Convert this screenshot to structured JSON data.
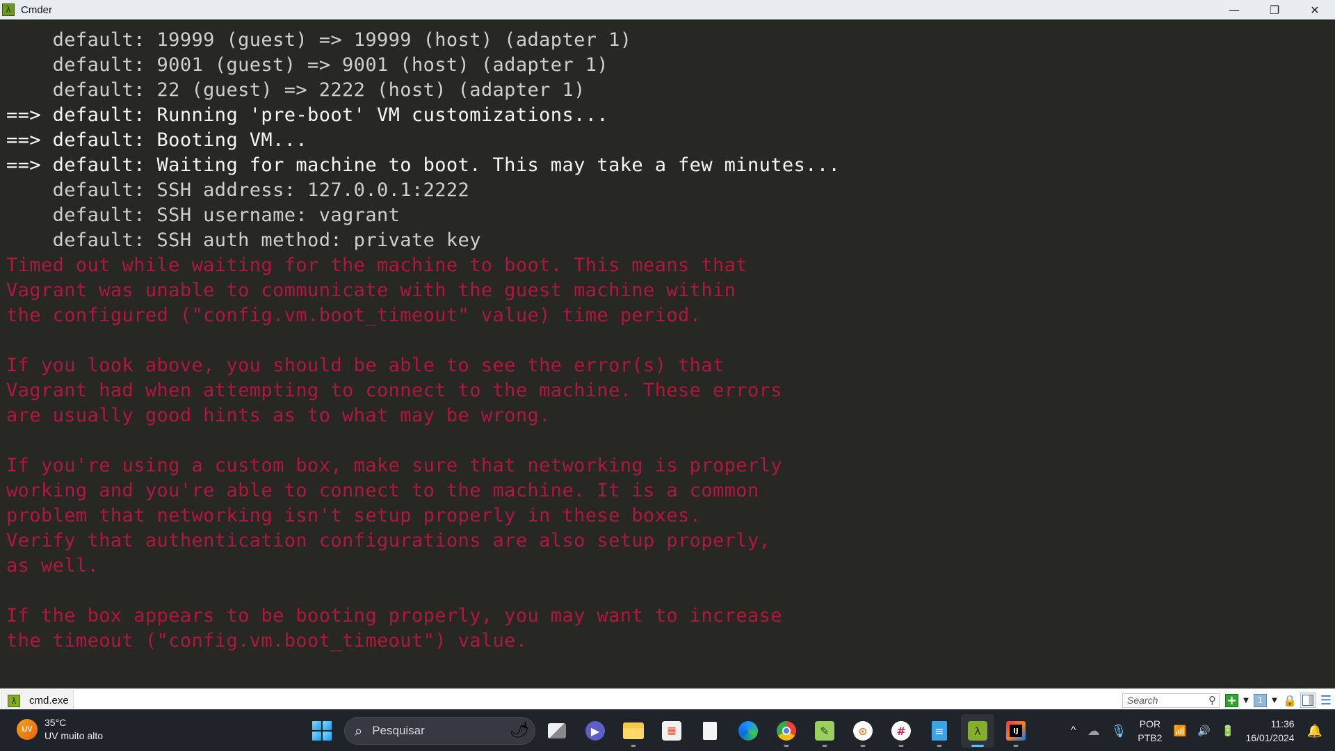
{
  "window": {
    "title": "Cmder",
    "app_icon": "lambda-icon",
    "controls": {
      "minimize": "—",
      "restore": "❐",
      "close": "✕"
    }
  },
  "terminal": {
    "colors": {
      "background": "#272822",
      "info": "#d0d0c8",
      "action": "#f8f8f2",
      "error": "#b0173f"
    },
    "lines": [
      {
        "type": "info",
        "text": "    default: 19999 (guest) => 19999 (host) (adapter 1)"
      },
      {
        "type": "info",
        "text": "    default: 9001 (guest) => 9001 (host) (adapter 1)"
      },
      {
        "type": "info",
        "text": "    default: 22 (guest) => 2222 (host) (adapter 1)"
      },
      {
        "type": "action",
        "text": "==> default: Running 'pre-boot' VM customizations..."
      },
      {
        "type": "action",
        "text": "==> default: Booting VM..."
      },
      {
        "type": "action",
        "text": "==> default: Waiting for machine to boot. This may take a few minutes..."
      },
      {
        "type": "info",
        "text": "    default: SSH address: 127.0.0.1:2222"
      },
      {
        "type": "info",
        "text": "    default: SSH username: vagrant"
      },
      {
        "type": "info",
        "text": "    default: SSH auth method: private key"
      },
      {
        "type": "error",
        "text": "Timed out while waiting for the machine to boot. This means that"
      },
      {
        "type": "error",
        "text": "Vagrant was unable to communicate with the guest machine within"
      },
      {
        "type": "error",
        "text": "the configured (\"config.vm.boot_timeout\" value) time period."
      },
      {
        "type": "error",
        "text": ""
      },
      {
        "type": "error",
        "text": "If you look above, you should be able to see the error(s) that"
      },
      {
        "type": "error",
        "text": "Vagrant had when attempting to connect to the machine. These errors"
      },
      {
        "type": "error",
        "text": "are usually good hints as to what may be wrong."
      },
      {
        "type": "error",
        "text": ""
      },
      {
        "type": "error",
        "text": "If you're using a custom box, make sure that networking is properly"
      },
      {
        "type": "error",
        "text": "working and you're able to connect to the machine. It is a common"
      },
      {
        "type": "error",
        "text": "problem that networking isn't setup properly in these boxes."
      },
      {
        "type": "error",
        "text": "Verify that authentication configurations are also setup properly,"
      },
      {
        "type": "error",
        "text": "as well."
      },
      {
        "type": "error",
        "text": ""
      },
      {
        "type": "error",
        "text": "If the box appears to be booting properly, you may want to increase"
      },
      {
        "type": "error",
        "text": "the timeout (\"config.vm.boot_timeout\") value."
      }
    ]
  },
  "tabbar": {
    "tabs": [
      {
        "label": "cmd.exe",
        "icon": "lambda-icon",
        "active": true
      }
    ],
    "search_placeholder": "Search",
    "search_value": "",
    "tools": {
      "search_glyph": "⚲",
      "new_console": "+",
      "caret": "▼",
      "console_number": "1",
      "lock": "🔒",
      "menu": "☰"
    }
  },
  "taskbar": {
    "weather": {
      "badge": "UV",
      "temperature": "35°C",
      "condition": "UV muito alto"
    },
    "search": {
      "label": "Pesquisar",
      "icon": "🔍",
      "decoration": "🌶"
    },
    "apps": [
      {
        "name": "task-view",
        "glyph": "",
        "running": false
      },
      {
        "name": "meet",
        "glyph": "▶",
        "running": false
      },
      {
        "name": "file-explorer",
        "glyph": "",
        "running": true
      },
      {
        "name": "microsoft-store",
        "glyph": "▦",
        "running": false
      },
      {
        "name": "blank-file",
        "glyph": "",
        "running": false
      },
      {
        "name": "edge",
        "glyph": "",
        "running": false
      },
      {
        "name": "chrome",
        "glyph": "",
        "running": true
      },
      {
        "name": "notepad-plus-plus",
        "glyph": "✎",
        "running": true
      },
      {
        "name": "openvpn",
        "glyph": "⊙",
        "running": true
      },
      {
        "name": "slack",
        "glyph": "#",
        "running": true
      },
      {
        "name": "notepad",
        "glyph": "≡",
        "running": true
      },
      {
        "name": "cmder",
        "glyph": "λ",
        "running": true,
        "active": true
      },
      {
        "name": "intellij",
        "glyph": "IJ",
        "running": true
      }
    ],
    "tray": {
      "chevron": "^",
      "cloud": "☁",
      "mic": "🎙",
      "language_line1": "POR",
      "language_line2": "PTB2",
      "wifi": "📶",
      "volume": "🔊",
      "battery": "🔋",
      "time": "11:36",
      "date": "16/01/2024",
      "bell": "🔔"
    }
  }
}
